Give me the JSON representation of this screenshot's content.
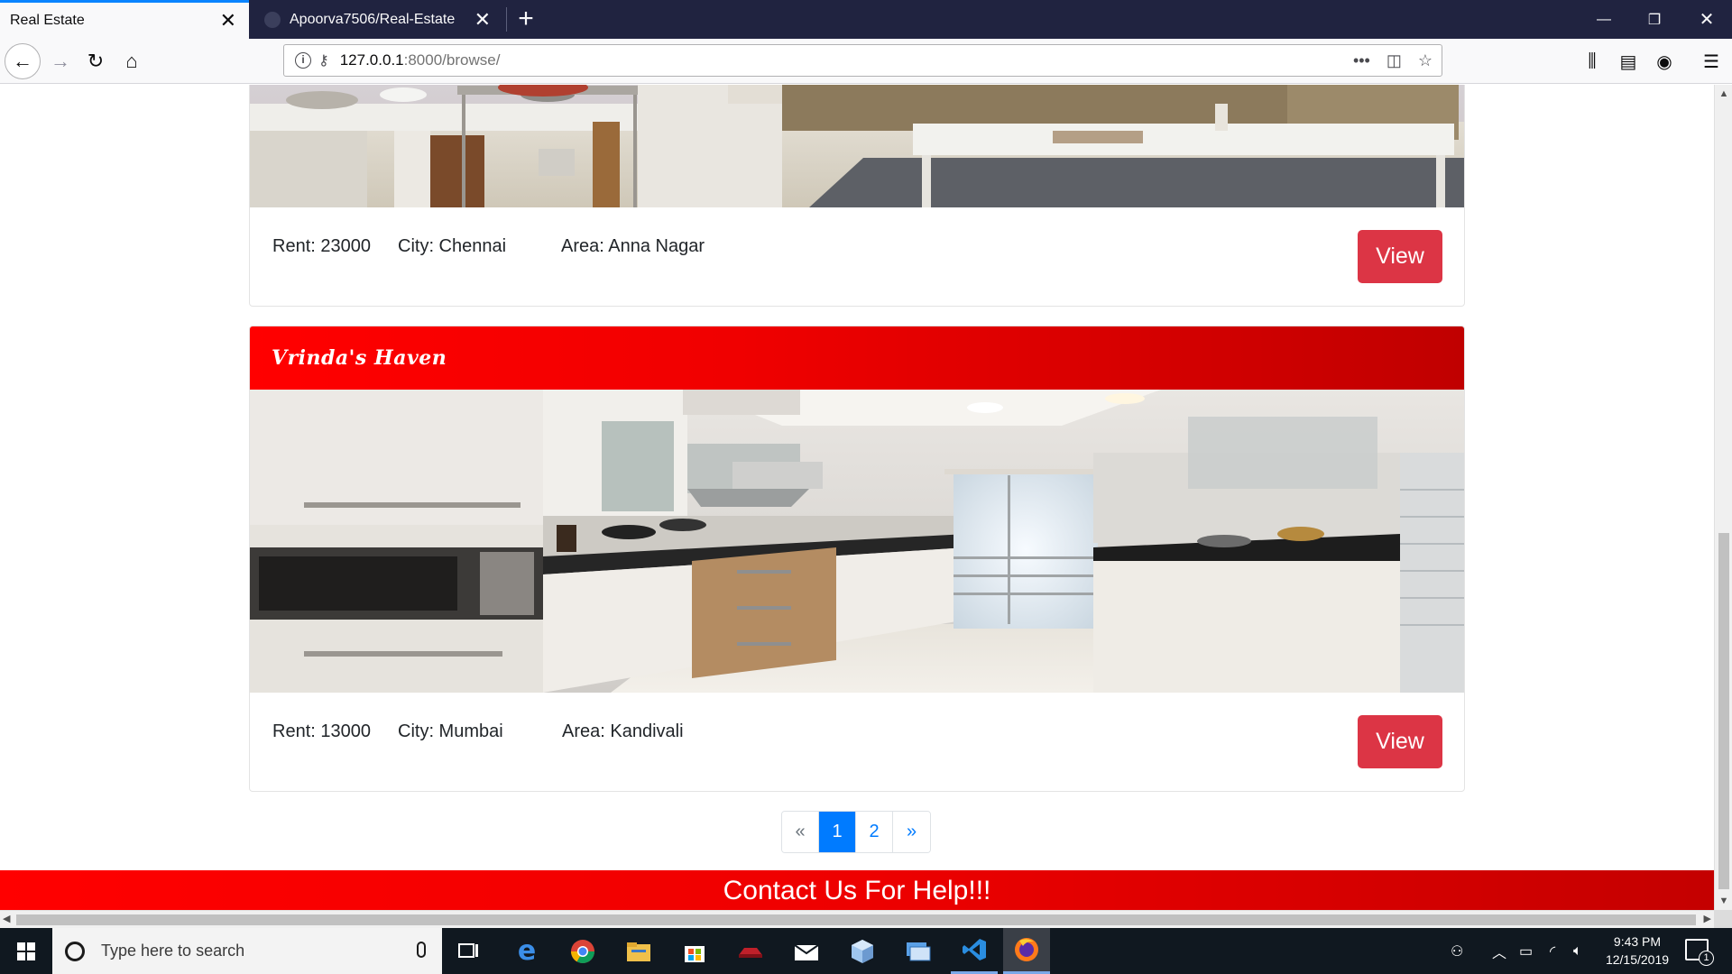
{
  "browser": {
    "tabs": [
      {
        "title": "Real Estate",
        "active": true
      },
      {
        "title": "Apoorva7506/Real-Estate",
        "active": false
      }
    ],
    "url_host": "127.0.0.1",
    "url_path": ":8000/browse/",
    "url_actions_icon": "more-icon",
    "accent_color": "#0a84ff"
  },
  "listings": [
    {
      "title": "",
      "rent_label": "Rent: 23000",
      "city_label": "City: Chennai",
      "area_label": "Area: Anna Nagar",
      "view_label": "View",
      "image_icon": "living-room-photo"
    },
    {
      "title": "Vrinda's Haven",
      "rent_label": "Rent: 13000",
      "city_label": "City: Mumbai",
      "area_label": "Area: Kandivali",
      "view_label": "View",
      "image_icon": "kitchen-photo"
    }
  ],
  "pagination": {
    "prev": "«",
    "pages": [
      "1",
      "2"
    ],
    "current": "1",
    "next": "»"
  },
  "footer": {
    "text": "Contact Us For Help!!!",
    "color": "#ff0000"
  },
  "taskbar": {
    "search_placeholder": "Type here to search",
    "time": "9:43 PM",
    "date": "12/15/2019",
    "notification_count": "1"
  },
  "colors": {
    "header_red": "#ff0000",
    "view_button": "#dc3545",
    "pagination_active": "#007bff"
  }
}
